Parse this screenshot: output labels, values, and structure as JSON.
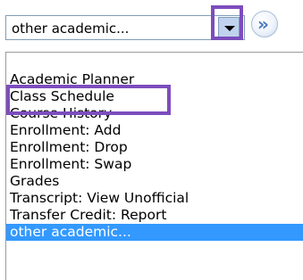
{
  "select": {
    "value": "other academic..."
  },
  "icons": {
    "dropdown": "dropdown-arrow-icon",
    "go": "double-chevron-right-icon",
    "go_glyph": "»"
  },
  "colors": {
    "highlight": "#7c4dbd",
    "selection": "#3399ff",
    "dropdown_button": "#c1d2ee",
    "go_chevron": "#4a78b8"
  },
  "options": [
    "Academic Planner",
    "Class Schedule",
    "Course History",
    "Enrollment: Add",
    "Enrollment: Drop",
    "Enrollment: Swap",
    "Grades",
    "Transcript: View Unofficial",
    "Transfer Credit: Report",
    "other academic..."
  ],
  "selected_option": "other academic...",
  "highlighted_option": "Class Schedule"
}
